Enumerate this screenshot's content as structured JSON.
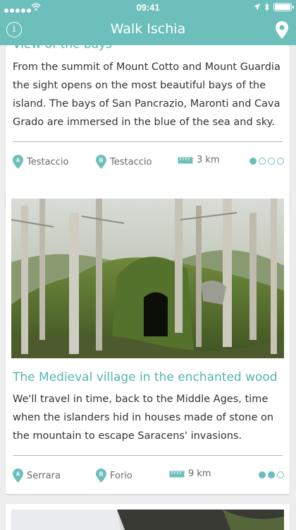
{
  "status_bar": {
    "time": "09:41"
  },
  "navbar": {
    "title": "Walk Ischia",
    "info_icon": "info-icon",
    "map_icon": "map-pin-icon"
  },
  "colors": {
    "accent": "#6cbfbb",
    "heading": "#55b5ae"
  },
  "walks": [
    {
      "title": "View of the bays",
      "description": "From the summit of Mount Cotto and Mount Guardia the sight opens on the most beautiful bays of the island. The bays of San Pancrazio, Maronti and Cava Grado are immersed in the blue of the sea and sky.",
      "start": "Testaccio",
      "end": "Testaccio",
      "distance": "3 km",
      "difficulty": 1,
      "difficulty_max": 4
    },
    {
      "title": "The Medieval village in the enchanted wood",
      "description": "We'll travel in time, back to the Middle Ages, time when the islanders hid in houses made of stone on the mountain to escape Saracens' invasions.",
      "start": "Serrara",
      "end": "Forio",
      "distance": "9 km",
      "difficulty": 2,
      "difficulty_max": 4
    }
  ]
}
